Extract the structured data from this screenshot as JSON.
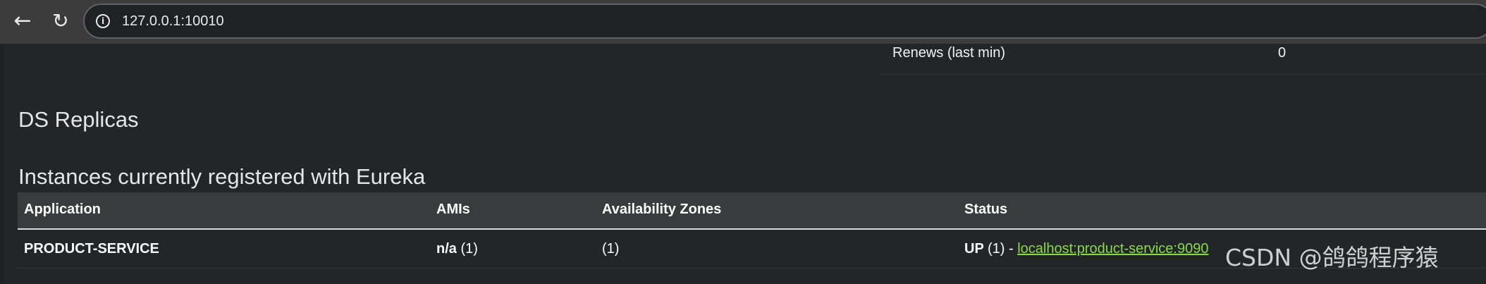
{
  "browser": {
    "url": "127.0.0.1:10010",
    "back_icon": "arrow-left-icon",
    "reload_icon": "reload-icon",
    "info_icon": "info-icon"
  },
  "renews": {
    "label": "Renews (last min)",
    "value": "0"
  },
  "headings": {
    "ds_replicas": "DS Replicas",
    "instances": "Instances currently registered with Eureka"
  },
  "table": {
    "headers": [
      "Application",
      "AMIs",
      "Availability Zones",
      "Status"
    ],
    "rows": [
      {
        "application": "PRODUCT-SERVICE",
        "amis_value": "n/a",
        "amis_count": "(1)",
        "zones": "(1)",
        "status": "UP",
        "status_count": "(1) -",
        "instance_link": "localhost:product-service:9090"
      }
    ]
  },
  "watermark": "CSDN @鸽鸽程序猿"
}
